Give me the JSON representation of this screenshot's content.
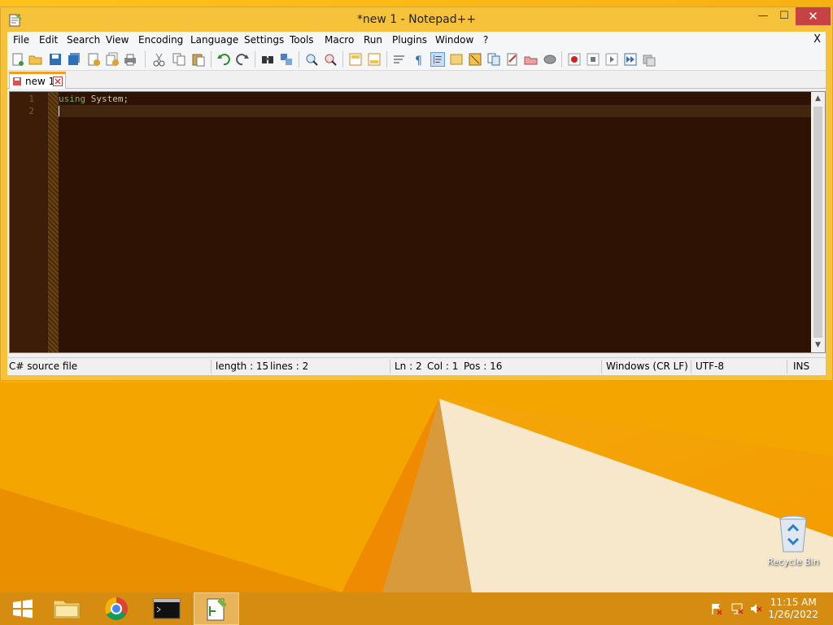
{
  "window": {
    "title": "*new 1 - Notepad++",
    "minimize": "—",
    "maximize": "☐",
    "close": "✕"
  },
  "menu": {
    "items": [
      "File",
      "Edit",
      "Search",
      "View",
      "Encoding",
      "Language",
      "Settings",
      "Tools",
      "Macro",
      "Run",
      "Plugins",
      "Window",
      "?"
    ],
    "close": "X"
  },
  "tabs": [
    {
      "label": "new 1"
    }
  ],
  "editor": {
    "line_numbers": [
      "1",
      "2"
    ],
    "line1_keyword": "using",
    "line1_rest": " System;",
    "scroll_up": "▲",
    "scroll_down": "▼"
  },
  "statusbar": {
    "filetype": "C# source file",
    "length": "length : 15",
    "lines": "lines : 2",
    "ln": "Ln : 2",
    "col": "Col : 1",
    "pos": "Pos : 16",
    "eol": "Windows (CR LF)",
    "encoding": "UTF-8",
    "mode": "INS"
  },
  "desktop": {
    "recycle_bin": "Recycle Bin"
  },
  "taskbar": {
    "time": "11:15 AM",
    "date": "1/26/2022"
  },
  "colors": {
    "editor_bg": "#2e1204",
    "keyword": "#7fb347",
    "tab_accent": "#f39c1f",
    "desktop": "#f7ad10"
  }
}
